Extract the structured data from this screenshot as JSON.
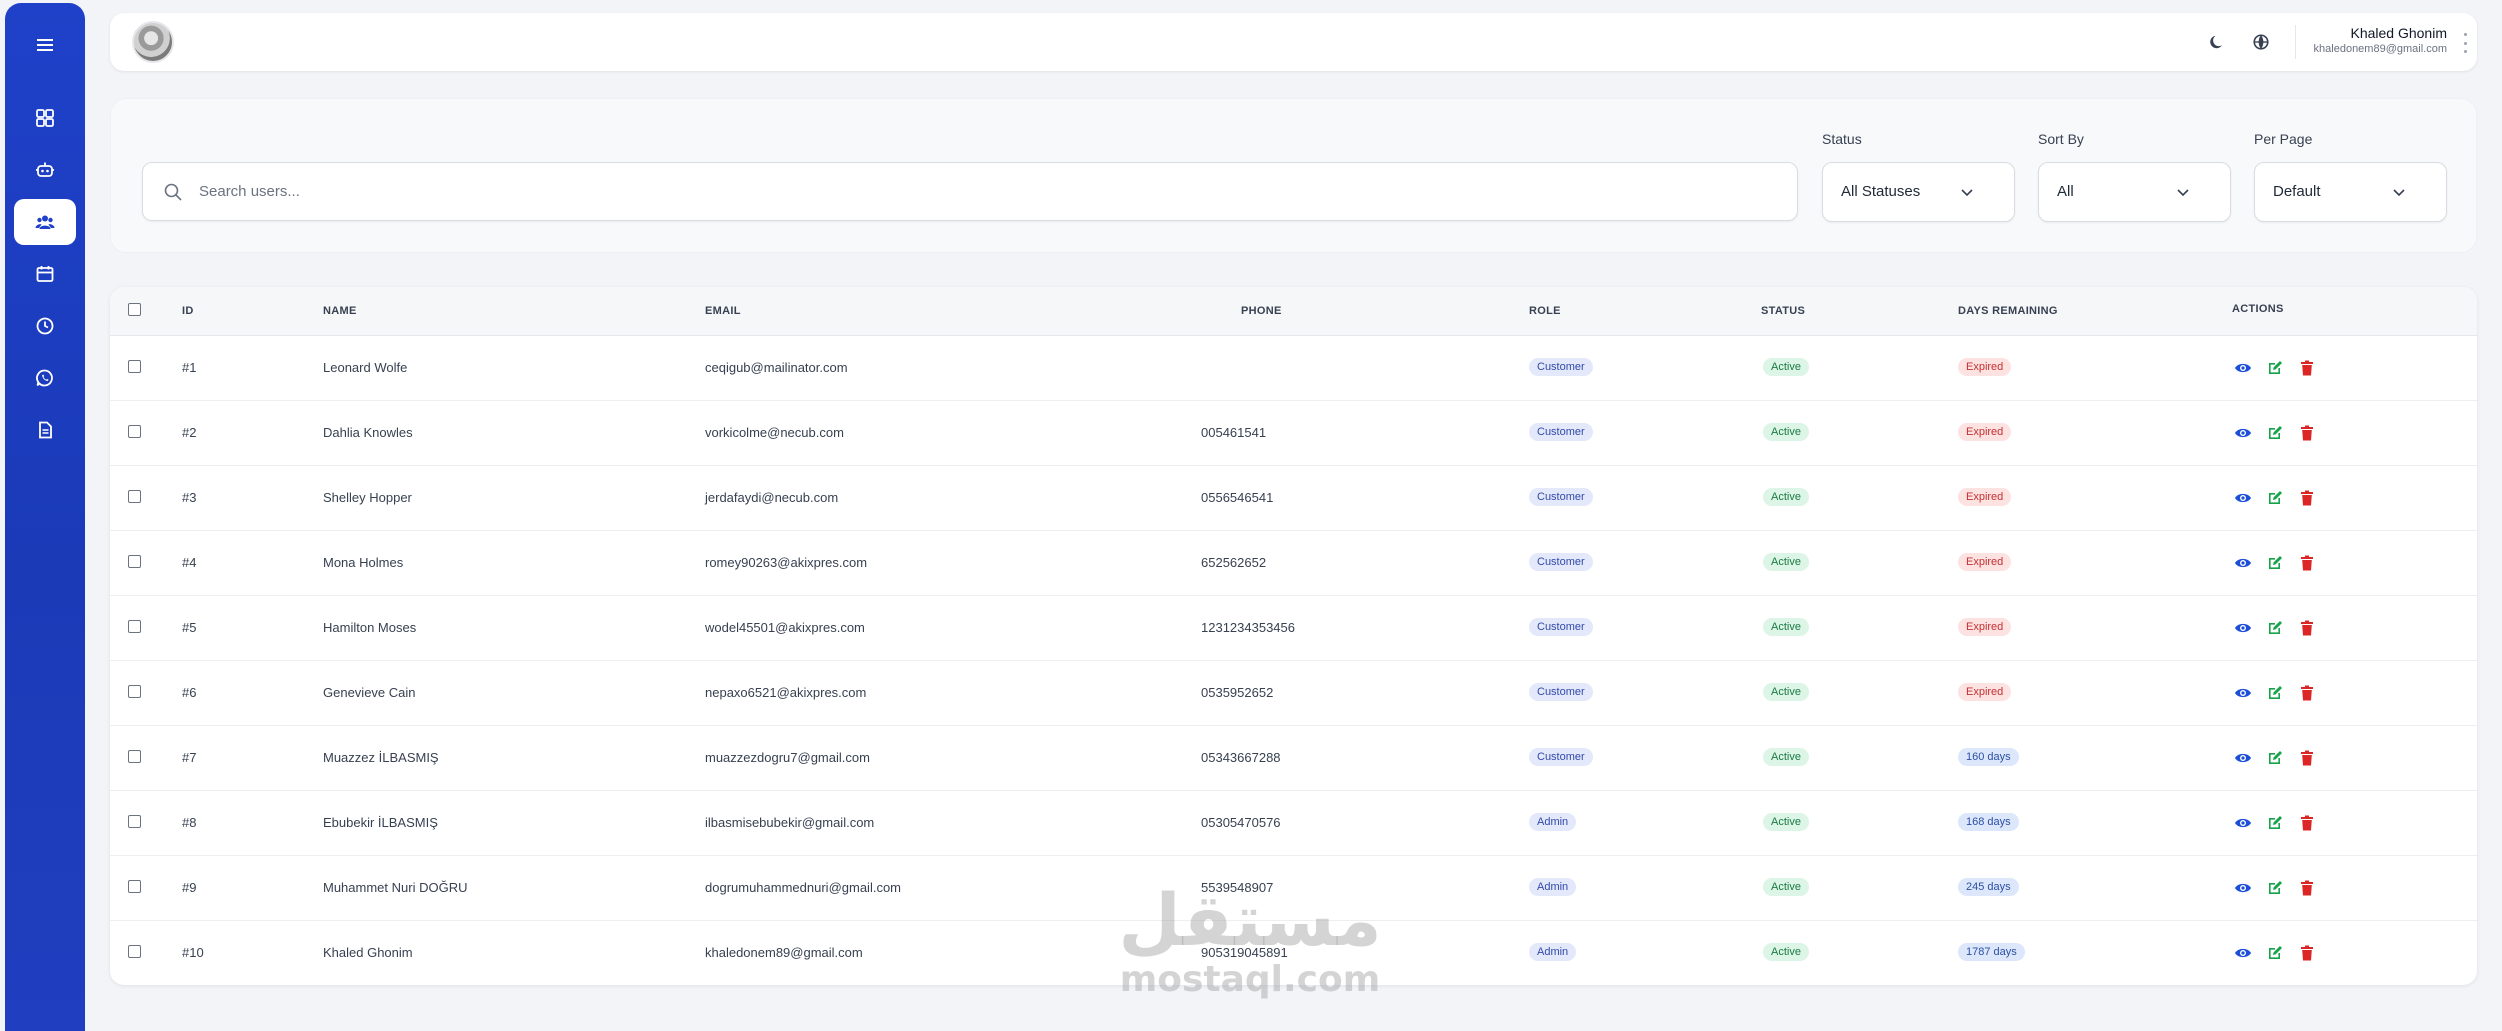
{
  "sidebar": {
    "items": [
      {
        "icon": "dashboard-icon"
      },
      {
        "icon": "robot-icon"
      },
      {
        "icon": "users-icon",
        "active": true
      },
      {
        "icon": "calendar-icon"
      },
      {
        "icon": "clock-icon"
      },
      {
        "icon": "whatsapp-icon"
      },
      {
        "icon": "document-icon"
      }
    ]
  },
  "topbar": {
    "user_name": "Khaled Ghonim",
    "user_email": "khaledonem89@gmail.com"
  },
  "filters": {
    "search_placeholder": "Search users...",
    "status_label": "Status",
    "status_value": "All Statuses",
    "sort_label": "Sort By",
    "sort_value": "All",
    "per_page_label": "Per Page",
    "per_page_value": "Default"
  },
  "table": {
    "headers": {
      "id": "ID",
      "name": "NAME",
      "email": "EMAIL",
      "phone": "PHONE",
      "role": "ROLE",
      "status": "STATUS",
      "days": "DAYS REMAINING",
      "actions": "ACTIONS"
    },
    "rows": [
      {
        "id": "#1",
        "name": "Leonard Wolfe",
        "email": "ceqigub@mailinator.com",
        "phone": "",
        "role": "Customer",
        "status": "Active",
        "days": "Expired"
      },
      {
        "id": "#2",
        "name": "Dahlia Knowles",
        "email": "vorkicolme@necub.com",
        "phone": "005461541",
        "role": "Customer",
        "status": "Active",
        "days": "Expired"
      },
      {
        "id": "#3",
        "name": "Shelley Hopper",
        "email": "jerdafaydi@necub.com",
        "phone": "0556546541",
        "role": "Customer",
        "status": "Active",
        "days": "Expired"
      },
      {
        "id": "#4",
        "name": "Mona Holmes",
        "email": "romey90263@akixpres.com",
        "phone": "652562652",
        "role": "Customer",
        "status": "Active",
        "days": "Expired"
      },
      {
        "id": "#5",
        "name": "Hamilton Moses",
        "email": "wodel45501@akixpres.com",
        "phone": "1231234353456",
        "role": "Customer",
        "status": "Active",
        "days": "Expired"
      },
      {
        "id": "#6",
        "name": "Genevieve Cain",
        "email": "nepaxo6521@akixpres.com",
        "phone": "0535952652",
        "role": "Customer",
        "status": "Active",
        "days": "Expired"
      },
      {
        "id": "#7",
        "name": "Muazzez İLBASMIŞ",
        "email": "muazzezdogru7@gmail.com",
        "phone": "05343667288",
        "role": "Customer",
        "status": "Active",
        "days": "160 days"
      },
      {
        "id": "#8",
        "name": "Ebubekir İLBASMIŞ",
        "email": "ilbasmisebubekir@gmail.com",
        "phone": "05305470576",
        "role": "Admin",
        "status": "Active",
        "days": "168 days"
      },
      {
        "id": "#9",
        "name": "Muhammet Nuri DOĞRU",
        "email": "dogrumuhammednuri@gmail.com",
        "phone": "5539548907",
        "role": "Admin",
        "status": "Active",
        "days": "245 days"
      },
      {
        "id": "#10",
        "name": "Khaled Ghonim",
        "email": "khaledonem89@gmail.com",
        "phone": "905319045891",
        "role": "Admin",
        "status": "Active",
        "days": "1787 days"
      }
    ]
  },
  "watermark": {
    "arabic": "مستقل",
    "latin": "mostaql.com"
  },
  "colors": {
    "sidebar": "#1f41c9",
    "view_action": "#1d4ed8",
    "edit_action": "#16a34a",
    "delete_action": "#dc2626"
  }
}
